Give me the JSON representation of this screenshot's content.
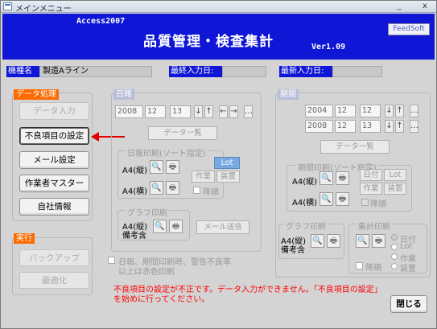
{
  "window": {
    "title": "メインメニュー",
    "min": "_",
    "close": "x"
  },
  "header": {
    "app": "Access2007",
    "title": "品質管理・検査集計",
    "version": "Ver1.09",
    "logo": "FeedSoft"
  },
  "info": {
    "model_label": "機種名",
    "model_value": "製造Aライン",
    "last_input_label": "最終入力日:",
    "latest_input_label": "最新入力日:"
  },
  "data_section": {
    "title": "データ処理",
    "buttons": [
      "データ入力",
      "不良項目の設定",
      "メール設定",
      "作業者マスター",
      "自社情報"
    ]
  },
  "exec_section": {
    "title": "実行",
    "buttons": [
      "バックアップ",
      "最適化"
    ]
  },
  "daily": {
    "title": "日報",
    "year": "2008",
    "month": "12",
    "day": "13",
    "view_button": "データ一覧",
    "print_title": "日報印刷(ソート指定)",
    "a4p": "A4(縦)",
    "a4l": "A4(横)",
    "lot": "Lot",
    "work": "作業",
    "device": "装置",
    "desc": "降順",
    "graph_title": "グラフ印刷",
    "graph_a4": "A4(縦)",
    "graph_note": "備考含",
    "mail_button": "メール送信"
  },
  "period": {
    "title": "期間",
    "from": {
      "year": "2004",
      "month": "12",
      "day": "12"
    },
    "to": {
      "year": "2008",
      "month": "12",
      "day": "13"
    },
    "view_button": "データ一覧",
    "print_title": "期間印刷(ソート指定)",
    "a4p": "A4(縦)",
    "a4l": "A4(横)",
    "date": "日付",
    "lot": "Lot",
    "work": "作業",
    "device": "装置",
    "desc": "降順",
    "graph_title": "グラフ印刷",
    "graph_a4": "A4(縦)",
    "graph_note": "備考含",
    "agg_title": "集計印刷",
    "agg_opts": [
      "日付",
      "Lot",
      "作業",
      "装置"
    ],
    "agg_desc": "降順"
  },
  "red_check": {
    "line1": "日報、期間印刷時、警告不良率",
    "line2": "以上は赤色印刷"
  },
  "warning": "不良項目の設定が不正です。データ入力ができません。「不良項目の設定」を始めに行ってください。",
  "close_button": "閉じる",
  "arrow_color": "#e00000"
}
